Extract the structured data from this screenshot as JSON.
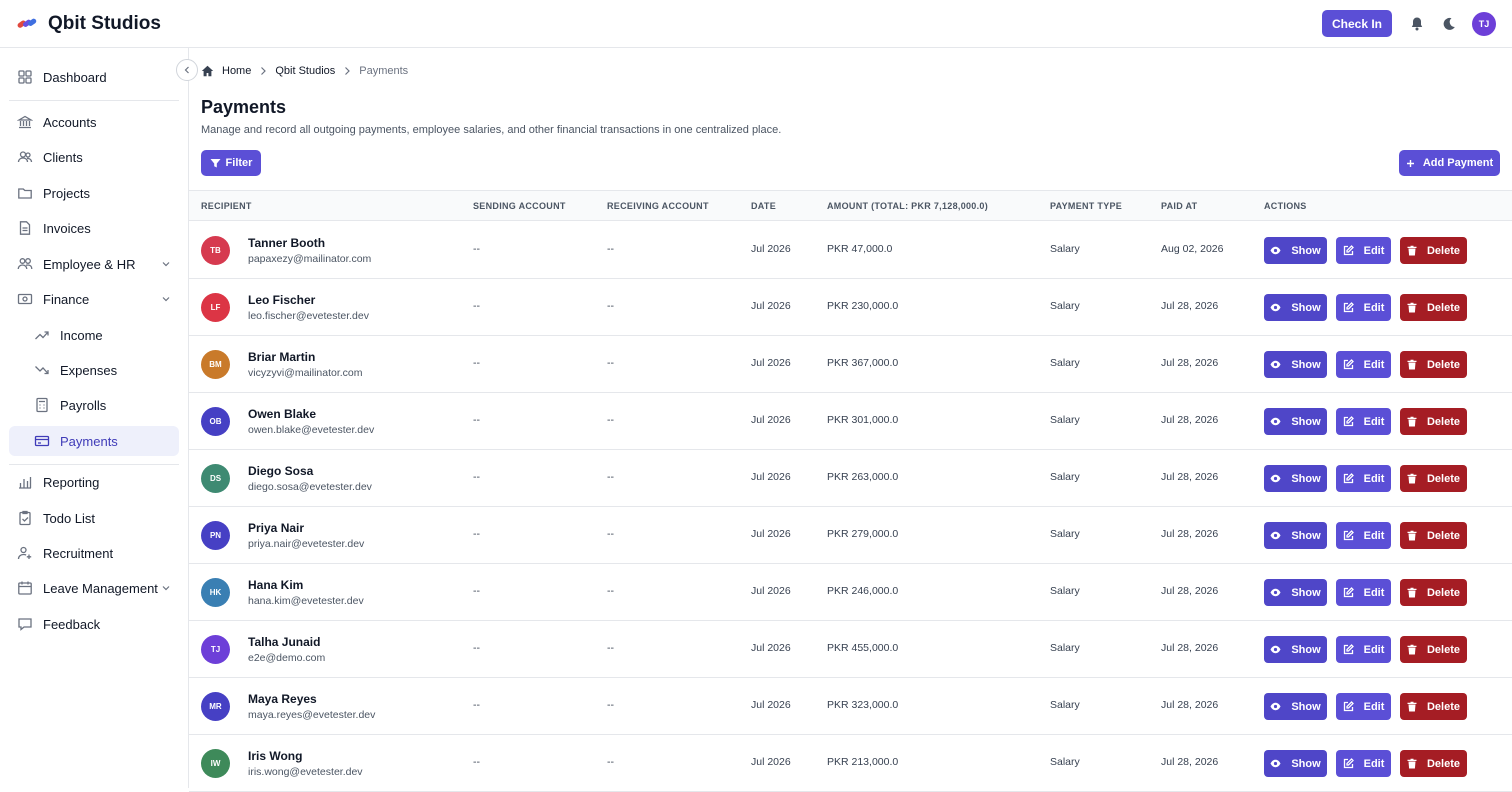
{
  "app": {
    "title": "Qbit Studios",
    "check_in_label": "Check In",
    "user_initials": "TJ"
  },
  "sidebar": {
    "items": [
      {
        "label": "Dashboard",
        "icon": "grid-icon"
      },
      {
        "label": "Accounts",
        "icon": "bank-icon"
      },
      {
        "label": "Clients",
        "icon": "users-icon"
      },
      {
        "label": "Projects",
        "icon": "folder-icon"
      },
      {
        "label": "Invoices",
        "icon": "document-icon"
      },
      {
        "label": "Employee & HR",
        "icon": "user-group-icon"
      },
      {
        "label": "Finance",
        "icon": "cash-icon"
      },
      {
        "label": "Income",
        "icon": "trend-up-icon"
      },
      {
        "label": "Expenses",
        "icon": "trend-down-icon"
      },
      {
        "label": "Payrolls",
        "icon": "calculator-icon"
      },
      {
        "label": "Payments",
        "icon": "credit-card-icon"
      },
      {
        "label": "Reporting",
        "icon": "bar-chart-icon"
      },
      {
        "label": "Todo List",
        "icon": "checklist-icon"
      },
      {
        "label": "Recruitment",
        "icon": "user-plus-icon"
      },
      {
        "label": "Leave Management",
        "icon": "calendar-icon"
      },
      {
        "label": "Feedback",
        "icon": "chat-icon"
      }
    ]
  },
  "breadcrumb": {
    "home": "Home",
    "company": "Qbit Studios",
    "current": "Payments"
  },
  "page": {
    "title": "Payments",
    "description": "Manage and record all outgoing payments, employee salaries, and other financial transactions in one centralized place.",
    "filter_label": "Filter",
    "add_label": "Add Payment"
  },
  "table": {
    "headers": {
      "recipient": "RECIPIENT",
      "sending": "SENDING ACCOUNT",
      "receiving": "RECEIVING ACCOUNT",
      "date": "DATE",
      "amount": "AMOUNT",
      "amount_total": "(TOTAL: PKR 7,128,000.0)",
      "type": "PAYMENT TYPE",
      "paid_at": "PAID AT",
      "actions": "ACTIONS"
    },
    "action_labels": {
      "show": "Show",
      "edit": "Edit",
      "delete": "Delete"
    },
    "rows": [
      {
        "initials": "TB",
        "color": "#d63a4f",
        "name": "Tanner Booth",
        "email": "papaxezy@mailinator.com",
        "sending": "--",
        "receiving": "--",
        "date": "Jul 2026",
        "amount": "PKR 47,000.0",
        "type": "Salary",
        "paid_at": "Aug 02, 2026"
      },
      {
        "initials": "LF",
        "color": "#dc3545",
        "name": "Leo Fischer",
        "email": "leo.fischer@evetester.dev",
        "sending": "--",
        "receiving": "--",
        "date": "Jul 2026",
        "amount": "PKR 230,000.0",
        "type": "Salary",
        "paid_at": "Jul 28, 2026"
      },
      {
        "initials": "BM",
        "color": "#c97a2a",
        "name": "Briar Martin",
        "email": "vicyzyvi@mailinator.com",
        "sending": "--",
        "receiving": "--",
        "date": "Jul 2026",
        "amount": "PKR 367,000.0",
        "type": "Salary",
        "paid_at": "Jul 28, 2026"
      },
      {
        "initials": "OB",
        "color": "#4640c4",
        "name": "Owen Blake",
        "email": "owen.blake@evetester.dev",
        "sending": "--",
        "receiving": "--",
        "date": "Jul 2026",
        "amount": "PKR 301,000.0",
        "type": "Salary",
        "paid_at": "Jul 28, 2026"
      },
      {
        "initials": "DS",
        "color": "#3e8a72",
        "name": "Diego Sosa",
        "email": "diego.sosa@evetester.dev",
        "sending": "--",
        "receiving": "--",
        "date": "Jul 2026",
        "amount": "PKR 263,000.0",
        "type": "Salary",
        "paid_at": "Jul 28, 2026"
      },
      {
        "initials": "PN",
        "color": "#4640c4",
        "name": "Priya Nair",
        "email": "priya.nair@evetester.dev",
        "sending": "--",
        "receiving": "--",
        "date": "Jul 2026",
        "amount": "PKR 279,000.0",
        "type": "Salary",
        "paid_at": "Jul 28, 2026"
      },
      {
        "initials": "HK",
        "color": "#3a7fb3",
        "name": "Hana Kim",
        "email": "hana.kim@evetester.dev",
        "sending": "--",
        "receiving": "--",
        "date": "Jul 2026",
        "amount": "PKR 246,000.0",
        "type": "Salary",
        "paid_at": "Jul 28, 2026"
      },
      {
        "initials": "TJ",
        "color": "#6d3fd8",
        "name": "Talha Junaid",
        "email": "e2e@demo.com",
        "sending": "--",
        "receiving": "--",
        "date": "Jul 2026",
        "amount": "PKR 455,000.0",
        "type": "Salary",
        "paid_at": "Jul 28, 2026"
      },
      {
        "initials": "MR",
        "color": "#4640c4",
        "name": "Maya Reyes",
        "email": "maya.reyes@evetester.dev",
        "sending": "--",
        "receiving": "--",
        "date": "Jul 2026",
        "amount": "PKR 323,000.0",
        "type": "Salary",
        "paid_at": "Jul 28, 2026"
      },
      {
        "initials": "IW",
        "color": "#3e8a5a",
        "name": "Iris Wong",
        "email": "iris.wong@evetester.dev",
        "sending": "--",
        "receiving": "--",
        "date": "Jul 2026",
        "amount": "PKR 213,000.0",
        "type": "Salary",
        "paid_at": "Jul 28, 2026"
      }
    ]
  },
  "colors": {
    "accent": "#5b4fd6",
    "danger": "#a51d24",
    "active_bg": "#eef0fb"
  }
}
